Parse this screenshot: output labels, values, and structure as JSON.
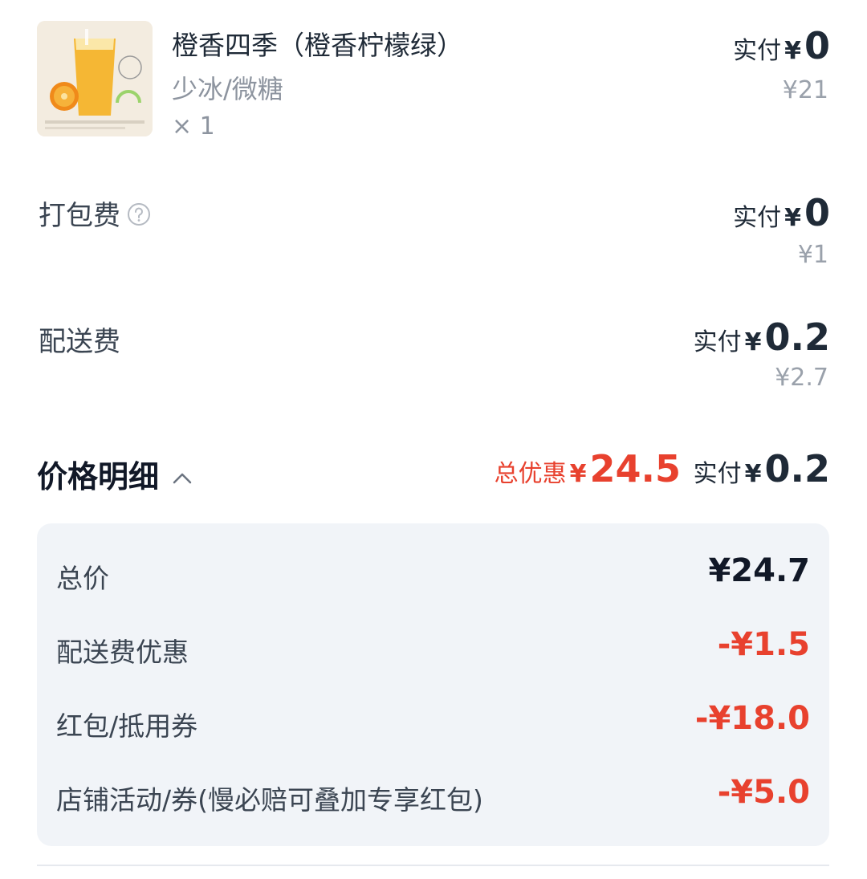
{
  "product": {
    "name": "橙香四季（橙香柠檬绿）",
    "spec": "少冰/微糖",
    "qty": "× 1",
    "pay_label": "实付",
    "pay_currency": "¥",
    "pay_amount": "0",
    "original_price": "¥21"
  },
  "packing_fee": {
    "label": "打包费",
    "pay_label": "实付",
    "pay_currency": "¥",
    "pay_amount": "0",
    "original_price": "¥1",
    "icon": "help-circle-icon"
  },
  "delivery_fee": {
    "label": "配送费",
    "pay_label": "实付",
    "pay_currency": "¥",
    "pay_amount": "0.2",
    "original_price": "¥2.7"
  },
  "price_detail": {
    "title": "价格明细",
    "discount_label": "总优惠",
    "discount_currency": "¥",
    "discount_amount": "24.5",
    "pay_label": "实付",
    "pay_currency": "¥",
    "pay_amount": "0.2",
    "rows": [
      {
        "label": "总价",
        "value": "¥24.7"
      },
      {
        "label": "配送费优惠",
        "value": "-¥1.5"
      },
      {
        "label": "红包/抵用券",
        "value": "-¥18.0"
      },
      {
        "label": "店铺活动/券(慢必赔可叠加专享红包)",
        "value": "-¥5.0"
      }
    ]
  },
  "colors": {
    "accent_red": "#e8412e",
    "text_dark": "#111827",
    "text_muted": "#9aa1ab",
    "box_bg": "#f1f4f8"
  }
}
